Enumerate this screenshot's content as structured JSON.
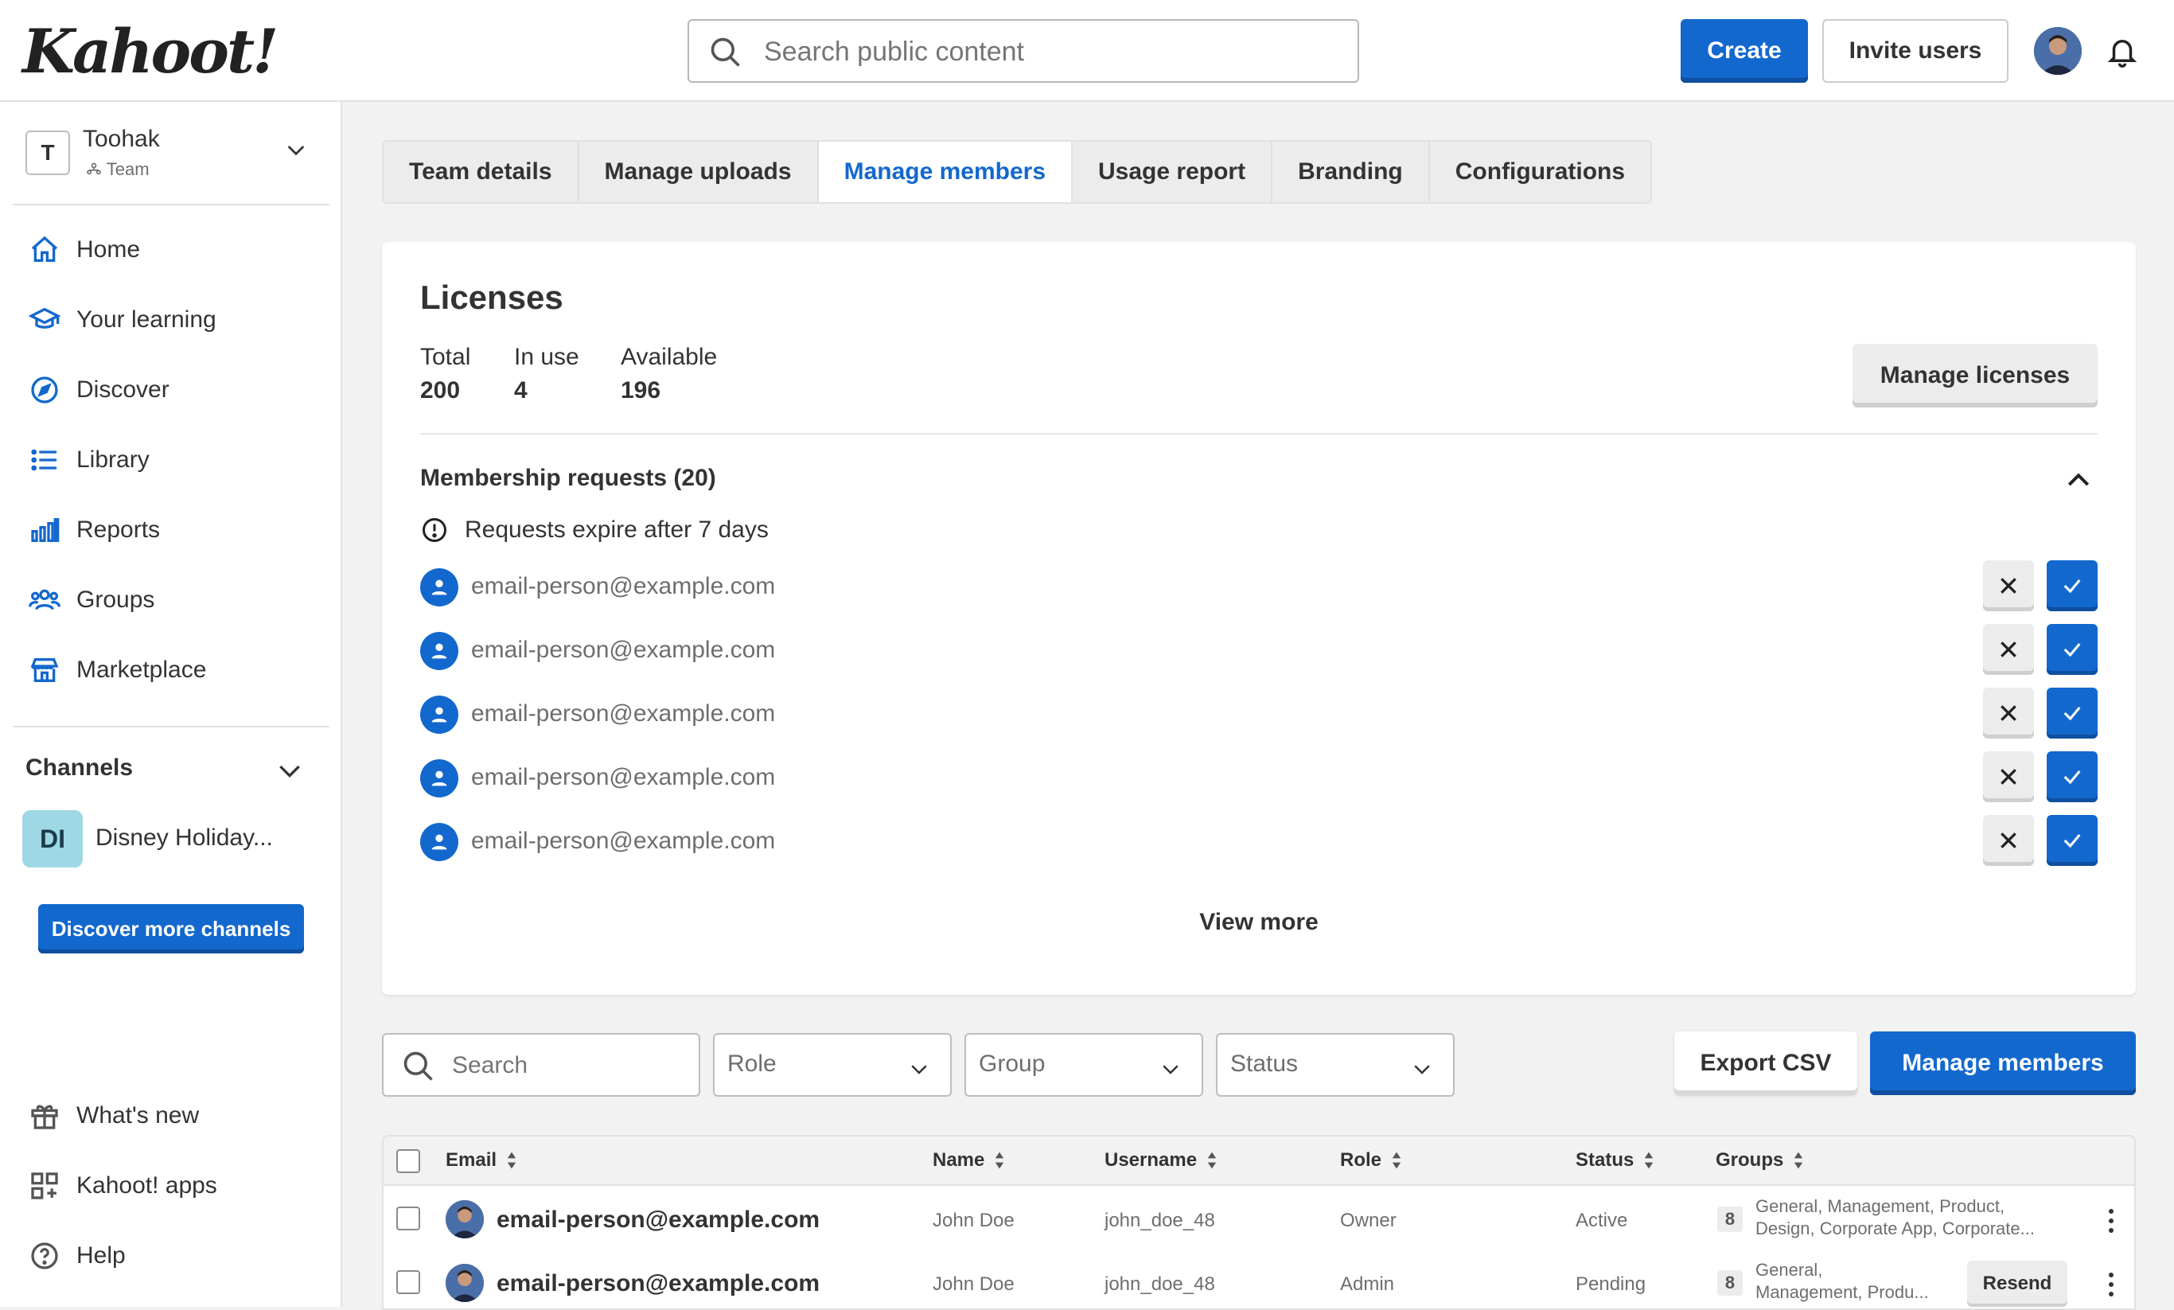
{
  "header": {
    "logo": "Kahoot!",
    "search_placeholder": "Search public content",
    "create_label": "Create",
    "invite_label": "Invite users"
  },
  "sidebar": {
    "team_initial": "T",
    "team_name": "Toohak",
    "team_type": "Team",
    "nav": [
      {
        "label": "Home",
        "icon": "home-icon"
      },
      {
        "label": "Your learning",
        "icon": "graduation-cap-icon"
      },
      {
        "label": "Discover",
        "icon": "compass-icon"
      },
      {
        "label": "Library",
        "icon": "list-icon"
      },
      {
        "label": "Reports",
        "icon": "bar-chart-icon"
      },
      {
        "label": "Groups",
        "icon": "people-icon"
      },
      {
        "label": "Marketplace",
        "icon": "store-icon"
      }
    ],
    "channels_title": "Channels",
    "channel": {
      "initials": "DI",
      "name": "Disney Holiday..."
    },
    "discover_channels_label": "Discover more channels",
    "bottom_nav": [
      {
        "label": "What's new",
        "icon": "gift-icon"
      },
      {
        "label": "Kahoot! apps",
        "icon": "apps-grid-icon"
      },
      {
        "label": "Help",
        "icon": "help-icon"
      }
    ]
  },
  "tabs": [
    {
      "label": "Team details",
      "active": false
    },
    {
      "label": "Manage uploads",
      "active": false
    },
    {
      "label": "Manage members",
      "active": true
    },
    {
      "label": "Usage report",
      "active": false
    },
    {
      "label": "Branding",
      "active": false
    },
    {
      "label": "Configurations",
      "active": false
    }
  ],
  "licenses": {
    "title": "Licenses",
    "total_label": "Total",
    "total_value": "200",
    "in_use_label": "In use",
    "in_use_value": "4",
    "available_label": "Available",
    "available_value": "196",
    "manage_label": "Manage licenses"
  },
  "requests": {
    "title": "Membership requests (20)",
    "note": "Requests expire after 7 days",
    "items": [
      "email-person@example.com",
      "email-person@example.com",
      "email-person@example.com",
      "email-person@example.com",
      "email-person@example.com"
    ],
    "view_more_label": "View more"
  },
  "filters": {
    "search_placeholder": "Search",
    "role_label": "Role",
    "group_label": "Group",
    "status_label": "Status",
    "export_label": "Export CSV",
    "manage_members_label": "Manage members"
  },
  "table": {
    "columns": [
      "Email",
      "Name",
      "Username",
      "Role",
      "Status",
      "Groups"
    ],
    "rows": [
      {
        "email": "email-person@example.com",
        "name": "John Doe",
        "username": "john_doe_48",
        "role": "Owner",
        "status": "Active",
        "group_count": "8",
        "groups_line1": "General, Management, Product,",
        "groups_line2": "Design, Corporate App, Corporate..."
      },
      {
        "email": "email-person@example.com",
        "name": "John Doe",
        "username": "john_doe_48",
        "role": "Admin",
        "status": "Pending",
        "group_count": "8",
        "groups_line1": "General,",
        "groups_line2": "Management, Produ...",
        "action_label": "Resend"
      }
    ]
  },
  "colors": {
    "accent": "#1368ce",
    "background": "#f2f2f2",
    "channel_badge": "#9ed8e4"
  }
}
